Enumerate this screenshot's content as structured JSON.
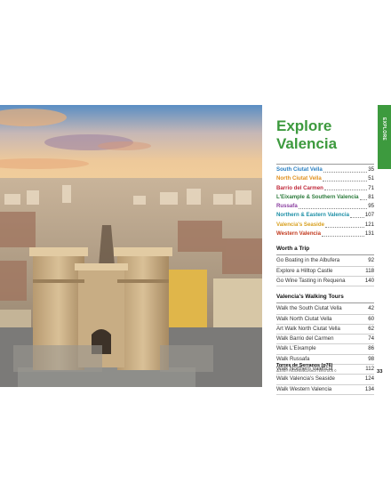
{
  "title_line1": "Explore",
  "title_line2": "Valencia",
  "side_tab": "EXPLORE",
  "page_number": "33",
  "toc": [
    {
      "label": "South Ciutat Vella",
      "page": "35",
      "color": "#2a7fc1"
    },
    {
      "label": "North Ciutat Vella",
      "page": "51",
      "color": "#e0901f"
    },
    {
      "label": "Barrio del Carmen",
      "page": "71",
      "color": "#c0283a"
    },
    {
      "label": "L'Eixample & Southern Valencia",
      "page": "81",
      "color": "#2b7a3a"
    },
    {
      "label": "Russafa",
      "page": "95",
      "color": "#8a3fa0"
    },
    {
      "label": "Northern & Eastern Valencia",
      "page": "107",
      "color": "#1d8fa6"
    },
    {
      "label": "Valencia's Seaside",
      "page": "121",
      "color": "#d8a020"
    },
    {
      "label": "Western Valencia",
      "page": "131",
      "color": "#c23a1e"
    }
  ],
  "worth_a_trip": {
    "heading": "Worth a Trip",
    "items": [
      {
        "label": "Go Boating in the Albufera",
        "page": "92"
      },
      {
        "label": "Explore a Hilltop Castle",
        "page": "118"
      },
      {
        "label": "Go Wine Tasting in Requena",
        "page": "140"
      }
    ]
  },
  "walking_tours": {
    "heading": "Valencia's Walking Tours",
    "items": [
      {
        "label": "Walk the South Ciutat Vella",
        "page": "42"
      },
      {
        "label": "Walk North Ciutat Vella",
        "page": "60"
      },
      {
        "label": "Art Walk North Ciutat Vella",
        "page": "62"
      },
      {
        "label": "Walk Barrio del Carmen",
        "page": "74"
      },
      {
        "label": "Walk L'Eixample",
        "page": "86"
      },
      {
        "label": "Walk Russafa",
        "page": "98"
      },
      {
        "label": "Walk Northern Valencia",
        "page": "112"
      },
      {
        "label": "Walk Valencia's Seaside",
        "page": "124"
      },
      {
        "label": "Walk Western Valencia",
        "page": "134"
      }
    ]
  },
  "caption": {
    "title": "Torres de Serranos (p76)",
    "credit": "ALEXEY FEDORENKO/SHUTTERSTOCK ©"
  }
}
